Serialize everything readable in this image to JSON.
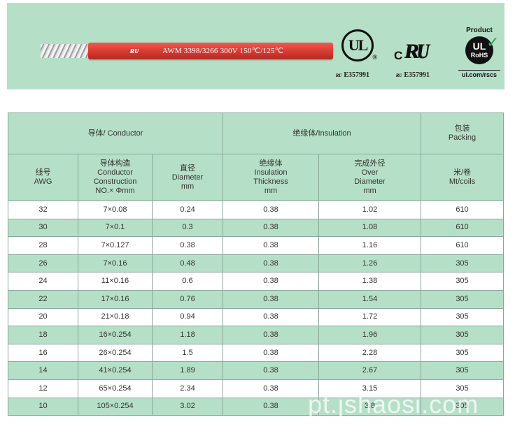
{
  "banner": {
    "wire_ur_mark": "ʀᴜ",
    "wire_print": "AWM 3398/3266  300V  150℃/125℃",
    "ul_mark": "UL",
    "ul_cert": "E357991",
    "cur_c": "C",
    "cur_mark": "ʀᴜ",
    "cur_cert": "E357991",
    "rohs_product": "Product",
    "rohs_ul": "UL",
    "rohs_rohs": "RoHS",
    "rohs_url": "ul.com/rscs"
  },
  "table": {
    "group_conductor": "导体/ Conductor",
    "group_insulation": "绝缘体/Insulation",
    "group_packing_cn": "包装",
    "group_packing_en": "Packing",
    "col_awg": [
      "线号",
      "AWG"
    ],
    "col_construction": [
      "导体构造",
      "Conductor",
      "Construction",
      "NO.× Φmm"
    ],
    "col_diameter": [
      "直径",
      "Diameter",
      "mm"
    ],
    "col_thickness": [
      "绝缘体",
      "Insulation",
      "Thickness",
      "mm"
    ],
    "col_over": [
      "完成外径",
      "Over",
      "Diameter",
      "mm"
    ],
    "col_packing": [
      "米/卷",
      "Mt/coils"
    ],
    "rows": [
      [
        "32",
        "7×0.08",
        "0.24",
        "0.38",
        "1.02",
        "610"
      ],
      [
        "30",
        "7×0.1",
        "0.3",
        "0.38",
        "1.08",
        "610"
      ],
      [
        "28",
        "7×0.127",
        "0.38",
        "0.38",
        "1.16",
        "610"
      ],
      [
        "26",
        "7×0.16",
        "0.48",
        "0.38",
        "1.26",
        "305"
      ],
      [
        "24",
        "11×0.16",
        "0.6",
        "0.38",
        "1.38",
        "305"
      ],
      [
        "22",
        "17×0.16",
        "0.76",
        "0.38",
        "1.54",
        "305"
      ],
      [
        "20",
        "21×0.18",
        "0.94",
        "0.38",
        "1.72",
        "305"
      ],
      [
        "18",
        "16×0.254",
        "1.18",
        "0.38",
        "1.96",
        "305"
      ],
      [
        "16",
        "26×0.254",
        "1.5",
        "0.38",
        "2.28",
        "305"
      ],
      [
        "14",
        "41×0.254",
        "1.89",
        "0.38",
        "2.67",
        "305"
      ],
      [
        "12",
        "65×0.254",
        "2.34",
        "0.38",
        "3.15",
        "305"
      ],
      [
        "10",
        "105×0.254",
        "3.02",
        "0.38",
        "3.8",
        "305"
      ]
    ]
  },
  "watermark": "pt.jshaosi.com",
  "colors": {
    "accent_green": "#b6dfc7",
    "wire_red": "#d63a30",
    "border": "#8aa89a"
  }
}
